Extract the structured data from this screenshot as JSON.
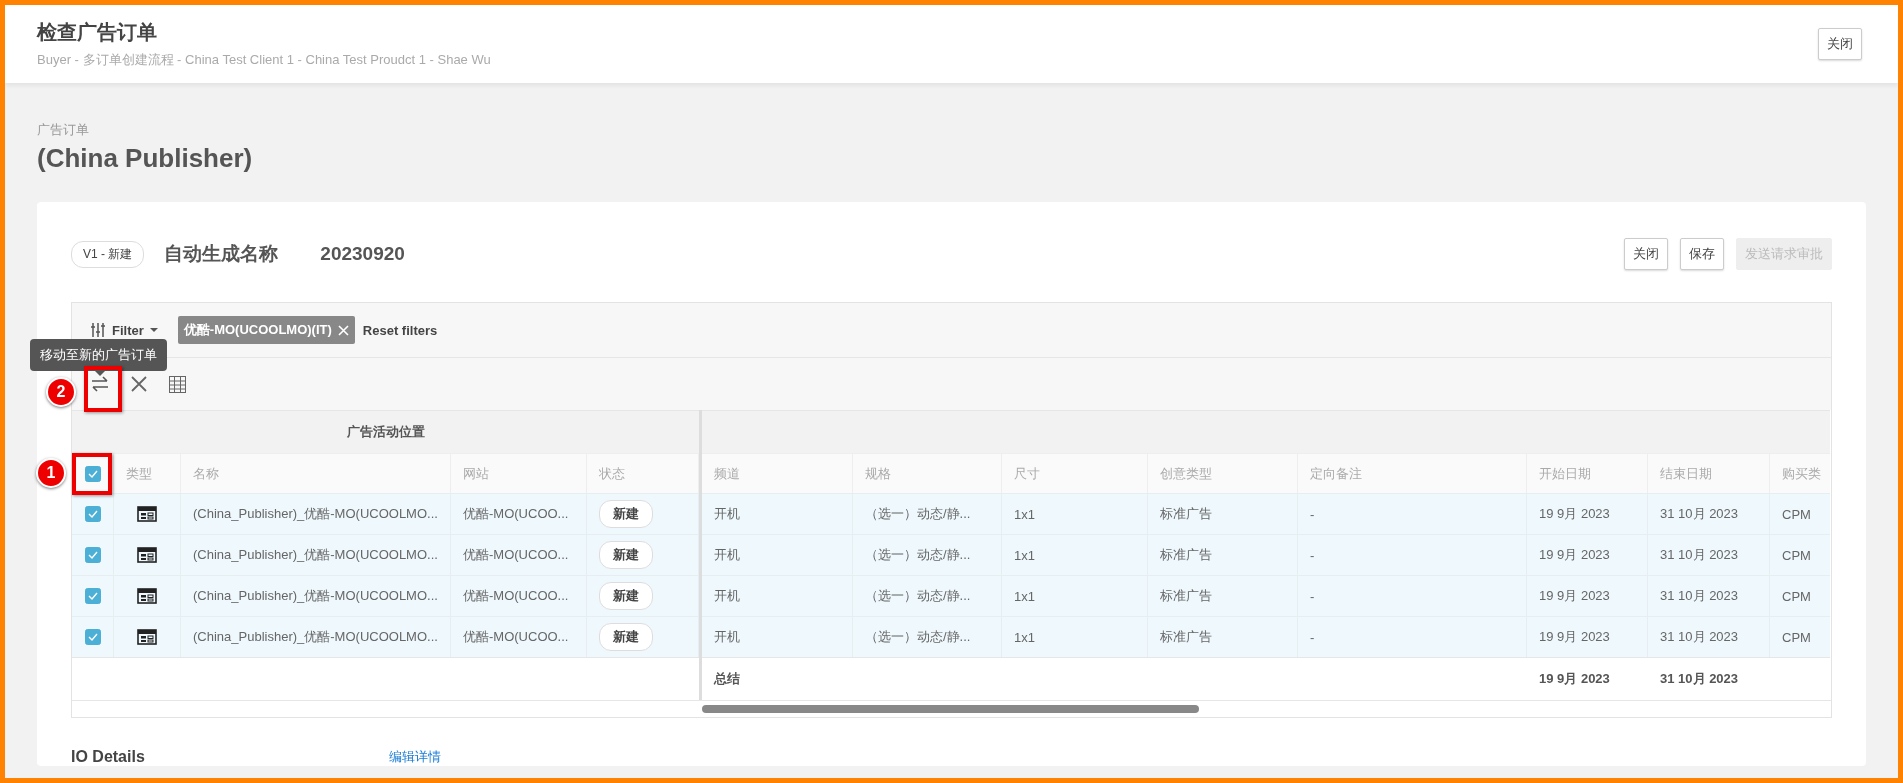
{
  "header": {
    "title": "检查广告订单",
    "subtitle": "Buyer - 多订单创建流程 - China Test Client 1 - China Test Proudct 1 - Shae Wu",
    "close_button": "关闭"
  },
  "page": {
    "breadcrumb": "广告订单",
    "title": "(China Publisher)"
  },
  "card": {
    "version_badge": "V1 - 新建",
    "name": "自动生成名称",
    "date": "20230920",
    "buttons": [
      {
        "label": "关闭",
        "disabled": false
      },
      {
        "label": "保存",
        "disabled": false
      },
      {
        "label": "发送请求审批",
        "disabled": true
      }
    ]
  },
  "filter": {
    "label": "Filter",
    "chips": [
      {
        "label": "优酷-MO(UCOOLMO)(IT)"
      }
    ],
    "reset": "Reset filters"
  },
  "tooltip": "移动至新的广告订单",
  "table": {
    "group_header": "广告活动位置",
    "header_checked": true,
    "left_columns": [
      "类型",
      "名称",
      "网站",
      "状态"
    ],
    "right_columns": [
      "频道",
      "规格",
      "尺寸",
      "创意类型",
      "定向备注",
      "开始日期",
      "结束日期",
      "购买类"
    ],
    "rows": [
      {
        "checked": true,
        "name": "(China_Publisher)_优酷-MO(UCOOLMO...",
        "site": "优酷-MO(UCOO...",
        "status": "新建",
        "channel": "开机",
        "spec": "（选一）动态/静...",
        "size": "1x1",
        "creative_type": "标准广告",
        "targeting_note": "-",
        "start": "19 9月 2023",
        "end": "31 10月 2023",
        "buy_type": "CPM"
      },
      {
        "checked": true,
        "name": "(China_Publisher)_优酷-MO(UCOOLMO...",
        "site": "优酷-MO(UCOO...",
        "status": "新建",
        "channel": "开机",
        "spec": "（选一）动态/静...",
        "size": "1x1",
        "creative_type": "标准广告",
        "targeting_note": "-",
        "start": "19 9月 2023",
        "end": "31 10月 2023",
        "buy_type": "CPM"
      },
      {
        "checked": true,
        "name": "(China_Publisher)_优酷-MO(UCOOLMO...",
        "site": "优酷-MO(UCOO...",
        "status": "新建",
        "channel": "开机",
        "spec": "（选一）动态/静...",
        "size": "1x1",
        "creative_type": "标准广告",
        "targeting_note": "-",
        "start": "19 9月 2023",
        "end": "31 10月 2023",
        "buy_type": "CPM"
      },
      {
        "checked": true,
        "name": "(China_Publisher)_优酷-MO(UCOOLMO...",
        "site": "优酷-MO(UCOO...",
        "status": "新建",
        "channel": "开机",
        "spec": "（选一）动态/静...",
        "size": "1x1",
        "creative_type": "标准广告",
        "targeting_note": "-",
        "start": "19 9月 2023",
        "end": "31 10月 2023",
        "buy_type": "CPM"
      }
    ],
    "summary": {
      "label": "总结",
      "start": "19 9月 2023",
      "end": "31 10月 2023"
    }
  },
  "annotations": [
    {
      "label": "1"
    },
    {
      "label": "2"
    }
  ],
  "details": {
    "title": "IO Details",
    "link": "编辑详情"
  }
}
